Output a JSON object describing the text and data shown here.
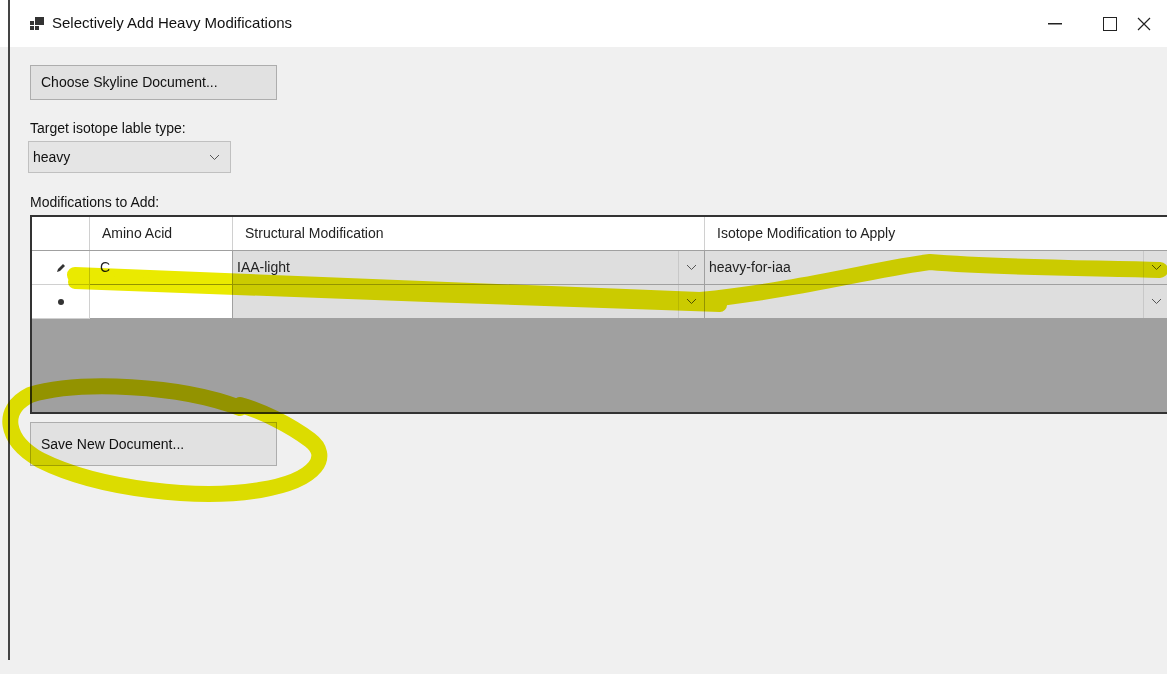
{
  "window": {
    "title": "Selectively Add Heavy Modifications"
  },
  "choose_button": {
    "label": "Choose Skyline Document..."
  },
  "target_label": "Target isotope lable type:",
  "target_combo": {
    "value": "heavy"
  },
  "grid_label": "Modifications to Add:",
  "grid": {
    "columns": [
      "Amino Acid",
      "Structural Modification",
      "Isotope Modification to Apply"
    ],
    "rows": [
      {
        "kind": "editing",
        "amino_acid": "C",
        "structural": "IAA-light",
        "isotope": "heavy-for-iaa"
      },
      {
        "kind": "new"
      }
    ]
  },
  "save_button": {
    "label": "Save New Document..."
  }
}
